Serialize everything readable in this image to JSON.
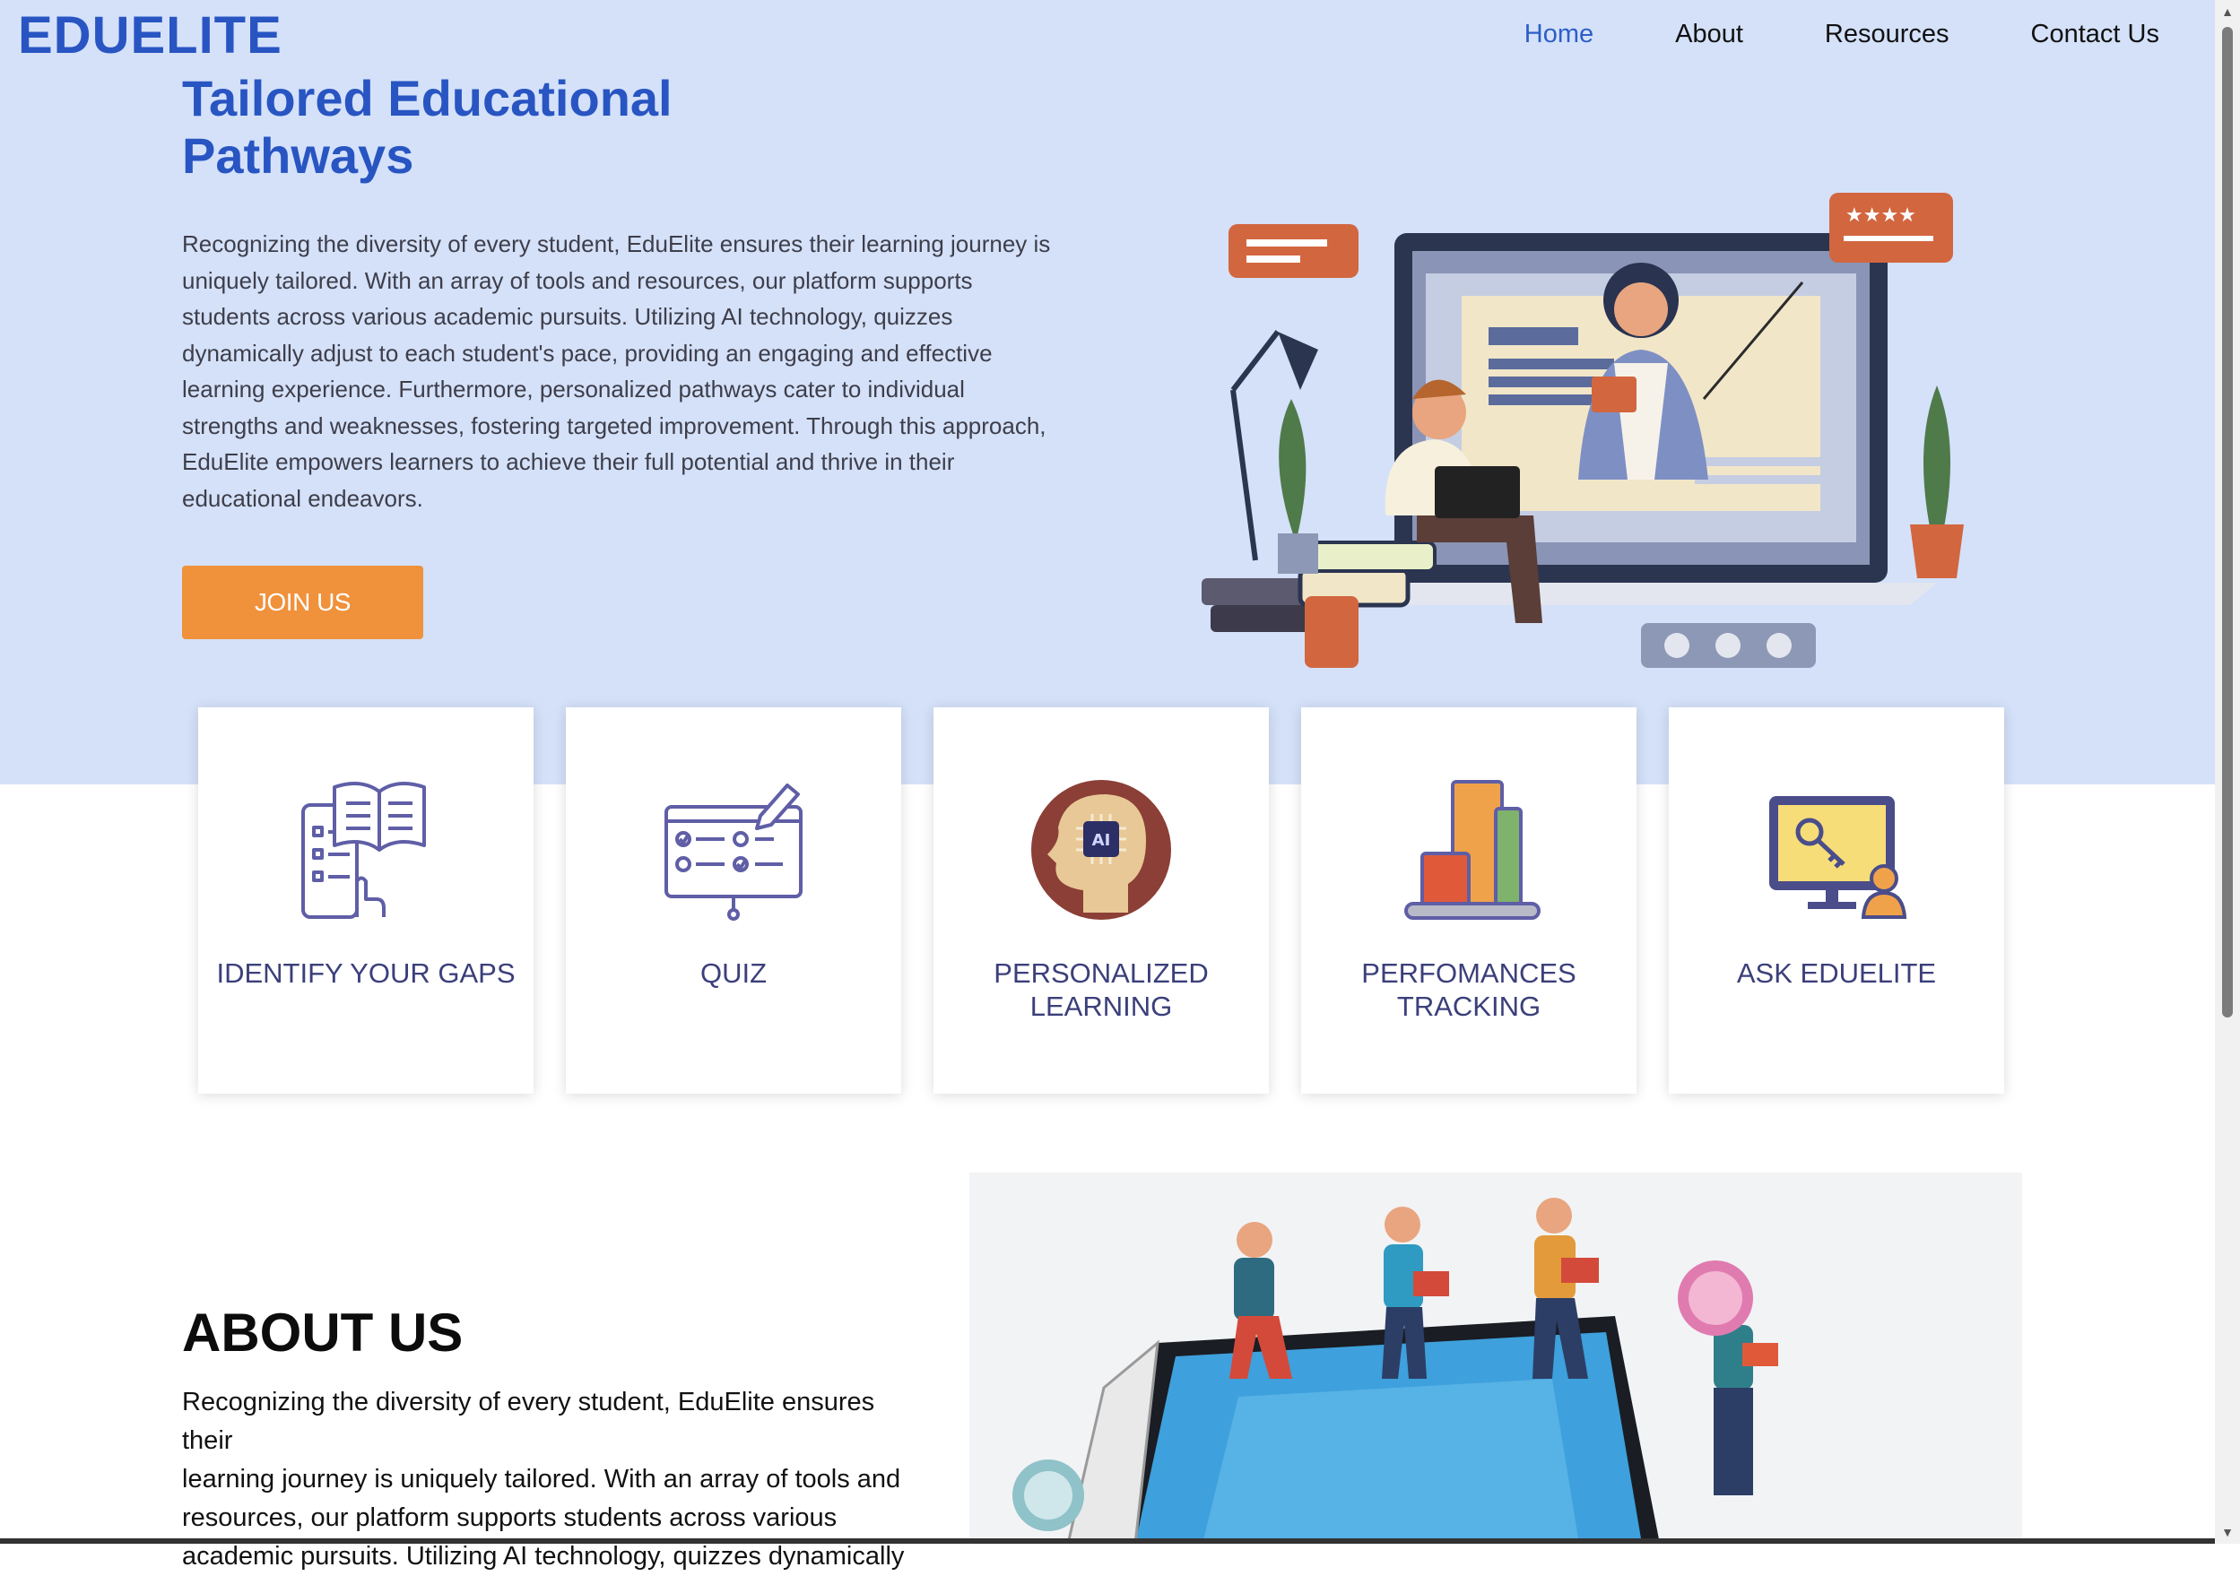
{
  "brand": {
    "logo": "EDUELITE"
  },
  "nav": {
    "items": [
      "Home",
      "About",
      "Resources",
      "Contact Us"
    ],
    "active": "Home"
  },
  "hero": {
    "title_line1": "Tailored Educational",
    "title_line2": "Pathways",
    "paragraph_lines": [
      "Recognizing the diversity of every student, EduElite ensures their learning journey is",
      "uniquely tailored. With an array of tools and resources, our platform supports",
      "students across various academic pursuits. Utilizing AI technology, quizzes",
      "dynamically adjust to each student's pace, providing an engaging and effective",
      "learning experience. Furthermore, personalized pathways cater to individual",
      "strengths and weaknesses, fostering targeted improvement. Through this approach,",
      "EduElite empowers learners to achieve their full potential and thrive in their",
      "educational endeavors."
    ],
    "cta_label": "JOIN US",
    "illustration_icon": "online-teacher-illustration"
  },
  "features": [
    {
      "line1": "IDENTIFY YOUR GAPS",
      "line2": "",
      "icon": "book-checklist-icon"
    },
    {
      "line1": "QUIZ",
      "line2": "",
      "icon": "quiz-monitor-icon"
    },
    {
      "line1": "PERSONALIZED",
      "line2": "LEARNING",
      "icon": "ai-head-icon"
    },
    {
      "line1": "PERFOMANCES",
      "line2": "TRACKING",
      "icon": "bar-chart-icon"
    },
    {
      "line1": "ASK EDUELITE",
      "line2": "",
      "icon": "key-monitor-icon"
    }
  ],
  "about": {
    "title": "ABOUT US",
    "paragraph_lines": [
      "Recognizing the diversity of every student, EduElite ensures their",
      "learning journey is uniquely tailored. With an array of tools and",
      "resources, our platform supports students across various",
      "academic pursuits. Utilizing AI technology, quizzes dynamically"
    ],
    "illustration_icon": "students-on-tablet-illustration"
  },
  "colors": {
    "brand_blue": "#2955c3",
    "hero_bg": "#d4e1f9",
    "cta_orange": "#f0913b",
    "card_text": "#3b3f7a"
  }
}
